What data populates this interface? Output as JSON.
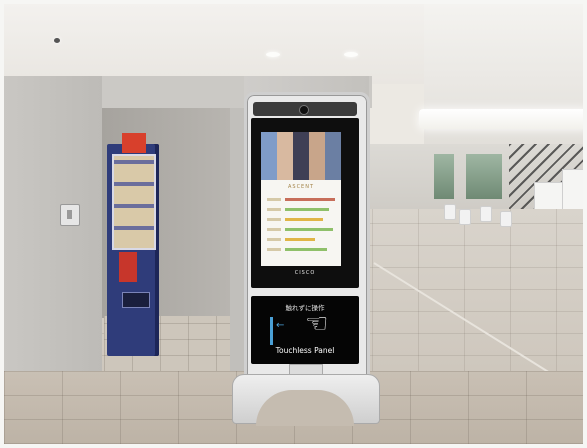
{
  "scene": "photo",
  "kiosk": {
    "display_logo": "ASCENT",
    "brand": "CISCO",
    "touch_instruction_jp": "触れずに操作",
    "touch_label": "Touchless Panel"
  },
  "colors": {
    "vending_body": "#2f3c7a",
    "touch_accent": "#4aa0d6",
    "screen_bg": "#0e0e0e"
  },
  "icons": {
    "hand": "pointing-hand-icon",
    "arrow": "left-arrow-icon",
    "camera": "camera-icon"
  }
}
